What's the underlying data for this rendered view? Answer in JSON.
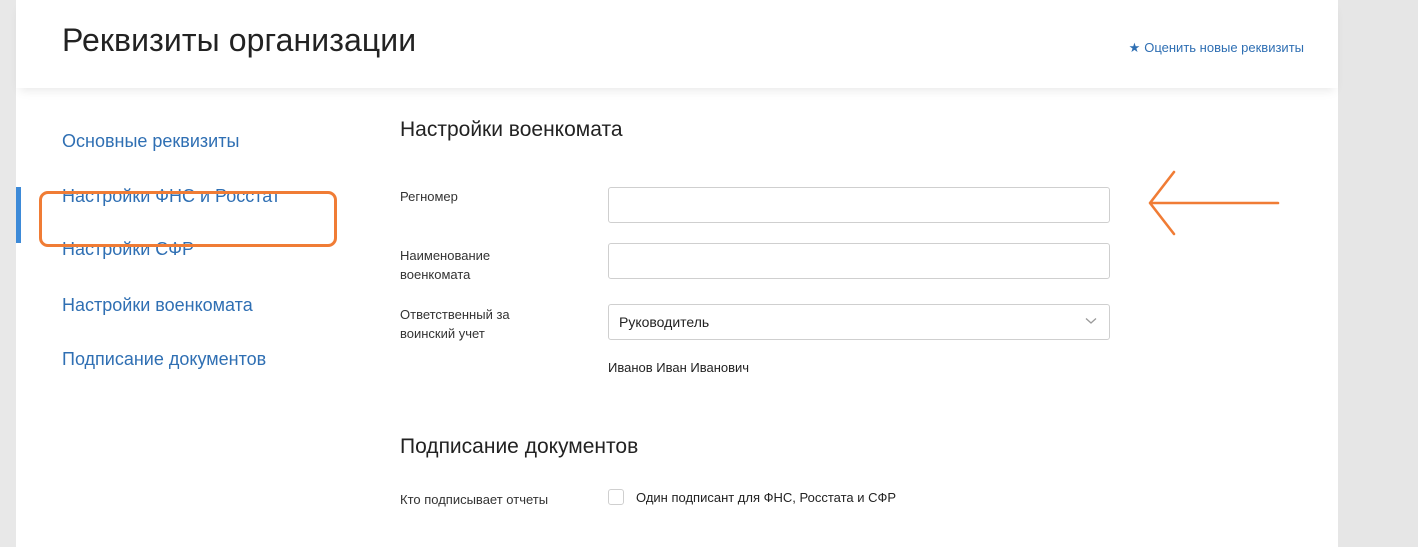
{
  "header": {
    "title": "Реквизиты организации",
    "rate_link": {
      "icon": "star-icon",
      "label": "Оценить новые реквизиты"
    }
  },
  "sidebar": {
    "items": [
      {
        "label": "Основные реквизиты",
        "active": false
      },
      {
        "label": "Настройки ФНС и Росстат",
        "active": false
      },
      {
        "label": "Настройки СФР",
        "active": false
      },
      {
        "label": "Настройки военкомата",
        "active": true
      },
      {
        "label": "Подписание документов",
        "active": false
      }
    ]
  },
  "military": {
    "section_title": "Настройки военкомата",
    "regnum": {
      "label": "Регномер",
      "value": ""
    },
    "office_name": {
      "label": "Наименование военкомата",
      "value": ""
    },
    "responsible": {
      "label": "Ответственный за воинский учет",
      "selected": "Руководитель",
      "person": "Иванов Иван Иванович"
    }
  },
  "signing": {
    "section_title": "Подписание документов",
    "who_label": "Кто подписывает отчеты",
    "single_signer": {
      "label": "Один подписант для ФНС, Росстата и СФР",
      "checked": false
    }
  },
  "colors": {
    "link": "#2f6fb3",
    "annotation": "#f07c35",
    "active_indicator": "#3d8ad8"
  }
}
